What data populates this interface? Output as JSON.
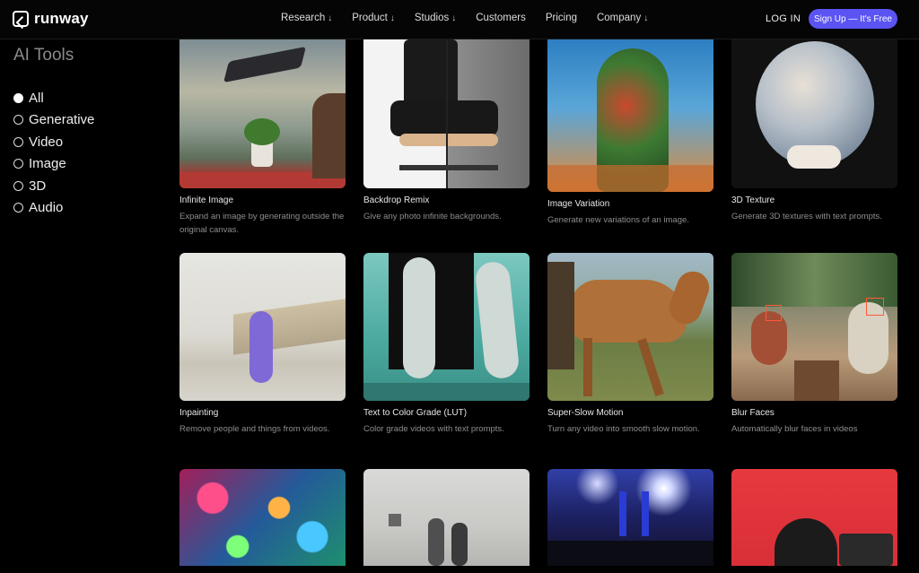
{
  "header": {
    "logo_text": "runway",
    "nav": [
      {
        "label": "Research",
        "dropdown": true
      },
      {
        "label": "Product",
        "dropdown": true
      },
      {
        "label": "Studios",
        "dropdown": true
      },
      {
        "label": "Customers",
        "dropdown": false
      },
      {
        "label": "Pricing",
        "dropdown": false
      },
      {
        "label": "Company",
        "dropdown": true
      }
    ],
    "login": "LOG IN",
    "signup": "Sign Up — It's Free",
    "accent": "#5b54f3"
  },
  "sidebar": {
    "title": "AI Tools",
    "filters": [
      {
        "label": "All",
        "selected": true
      },
      {
        "label": "Generative",
        "selected": false
      },
      {
        "label": "Video",
        "selected": false
      },
      {
        "label": "Image",
        "selected": false
      },
      {
        "label": "3D",
        "selected": false
      },
      {
        "label": "Audio",
        "selected": false
      }
    ]
  },
  "tools": [
    {
      "title": "Infinite Image",
      "desc": "Expand an image by generating outside the original canvas."
    },
    {
      "title": "Backdrop Remix",
      "desc": "Give any photo infinite backgrounds."
    },
    {
      "title": "Image Variation",
      "desc": "Generate new variations of an image."
    },
    {
      "title": "3D Texture",
      "desc": "Generate 3D textures with text prompts."
    },
    {
      "title": "Inpainting",
      "desc": "Remove people and things from videos."
    },
    {
      "title": "Text to Color Grade (LUT)",
      "desc": "Color grade videos with text prompts."
    },
    {
      "title": "Super-Slow Motion",
      "desc": "Turn any video into smooth slow motion."
    },
    {
      "title": "Blur Faces",
      "desc": "Automatically blur faces in videos"
    },
    {
      "title": "",
      "desc": ""
    },
    {
      "title": "",
      "desc": ""
    },
    {
      "title": "",
      "desc": ""
    },
    {
      "title": "",
      "desc": ""
    }
  ]
}
